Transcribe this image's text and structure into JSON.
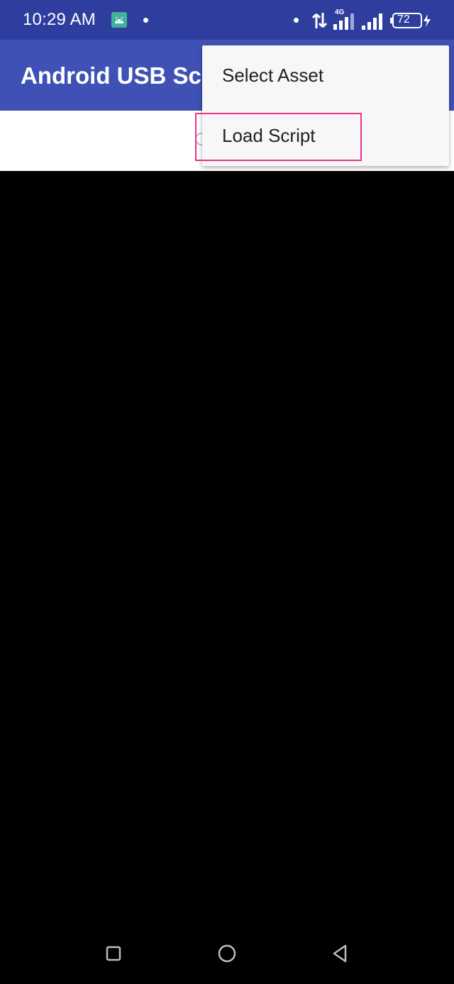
{
  "status_bar": {
    "time": "10:29 AM",
    "network_label": "4G",
    "battery_level": "72",
    "icons": [
      "android-notification-icon",
      "data-transfer-icon",
      "signal-4g-icon",
      "signal-icon",
      "battery-icon",
      "charging-icon"
    ]
  },
  "app_bar": {
    "title": "Android USB Scr"
  },
  "menu": {
    "items": [
      {
        "label": "Select Asset"
      },
      {
        "label": "Load Script"
      }
    ],
    "highlighted_index": 1
  },
  "nav_bar": {
    "icons": [
      "recents-icon",
      "home-icon",
      "back-icon"
    ]
  },
  "colors": {
    "status_bar": "#2f3e9e",
    "app_bar": "#3f51b5",
    "menu_background": "#f7f7f7",
    "highlight": "#e8338b"
  }
}
